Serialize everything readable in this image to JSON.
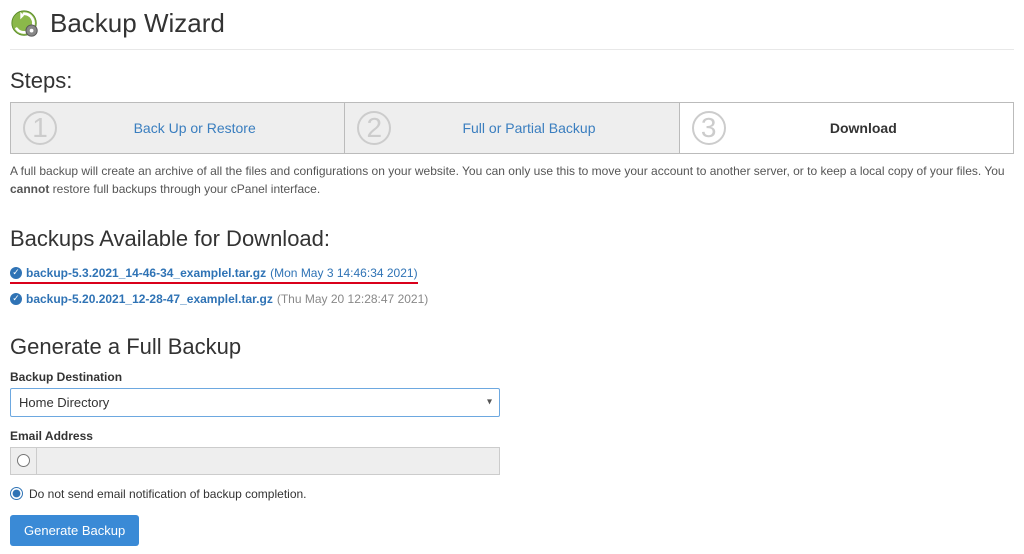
{
  "header": {
    "title": "Backup Wizard"
  },
  "steps": {
    "label": "Steps:",
    "items": [
      {
        "number": "1",
        "label": "Back Up or Restore",
        "active": false
      },
      {
        "number": "2",
        "label": "Full or Partial Backup",
        "active": false
      },
      {
        "number": "3",
        "label": "Download",
        "active": true
      }
    ]
  },
  "description": {
    "pre": "A full backup will create an archive of all the files and configurations on your website. You can only use this to move your account to another server, or to keep a local copy of your files. You ",
    "bold": "cannot",
    "post": " restore full backups through your cPanel interface."
  },
  "backups": {
    "title": "Backups Available for Download:",
    "items": [
      {
        "file": "backup-5.3.2021_14-46-34_examplel.tar.gz",
        "date": "(Mon May 3 14:46:34 2021)",
        "highlighted": true
      },
      {
        "file": "backup-5.20.2021_12-28-47_examplel.tar.gz",
        "date": "(Thu May 20 12:28:47 2021)",
        "highlighted": false
      }
    ]
  },
  "generate": {
    "title": "Generate a Full Backup",
    "destination_label": "Backup Destination",
    "destination_value": "Home Directory",
    "email_label": "Email Address",
    "no_email_label": "Do not send email notification of backup completion.",
    "button": "Generate Backup"
  }
}
